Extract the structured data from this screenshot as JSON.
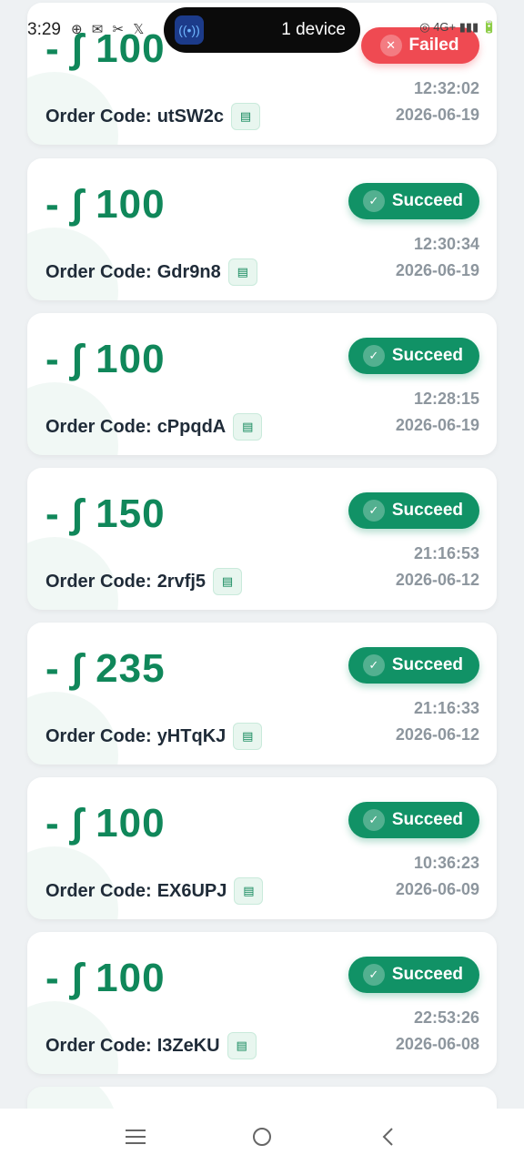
{
  "status_bar": {
    "time": "3:29",
    "left_icons": "⊕ ✉ ✂ 𝕏",
    "right_text": "◎ 4G+ ▮▮▮ 🔋"
  },
  "dynamic_island": {
    "icon": "nfc-signal-icon",
    "text": "1 device"
  },
  "orders": [
    {
      "amount": "- ∫ 100",
      "status": "Failed",
      "status_type": "failed",
      "code_label": "Order Code:",
      "code": "utSW2c",
      "time": "12:32:02",
      "date": "2026-06-19"
    },
    {
      "amount": "- ∫ 100",
      "status": "Succeed",
      "status_type": "success",
      "code_label": "Order Code:",
      "code": "Gdr9n8",
      "time": "12:30:34",
      "date": "2026-06-19"
    },
    {
      "amount": "- ∫ 100",
      "status": "Succeed",
      "status_type": "success",
      "code_label": "Order Code:",
      "code": "cPpqdA",
      "time": "12:28:15",
      "date": "2026-06-19"
    },
    {
      "amount": "- ∫ 150",
      "status": "Succeed",
      "status_type": "success",
      "code_label": "Order Code:",
      "code": "2rvfj5",
      "time": "21:16:53",
      "date": "2026-06-12"
    },
    {
      "amount": "- ∫ 235",
      "status": "Succeed",
      "status_type": "success",
      "code_label": "Order Code:",
      "code": "yHTqKJ",
      "time": "21:16:33",
      "date": "2026-06-12"
    },
    {
      "amount": "- ∫ 100",
      "status": "Succeed",
      "status_type": "success",
      "code_label": "Order Code:",
      "code": "EX6UPJ",
      "time": "10:36:23",
      "date": "2026-06-09"
    },
    {
      "amount": "- ∫ 100",
      "status": "Succeed",
      "status_type": "success",
      "code_label": "Order Code:",
      "code": "I3ZeKU",
      "time": "22:53:26",
      "date": "2026-06-08"
    }
  ],
  "colors": {
    "amount": "#10875a",
    "success": "#119266",
    "failed": "#ef4a52",
    "background": "#eef1f3"
  },
  "nav": {
    "recents_icon": "menu-icon",
    "home_icon": "home-circle-icon",
    "back_icon": "back-chevron-icon"
  }
}
